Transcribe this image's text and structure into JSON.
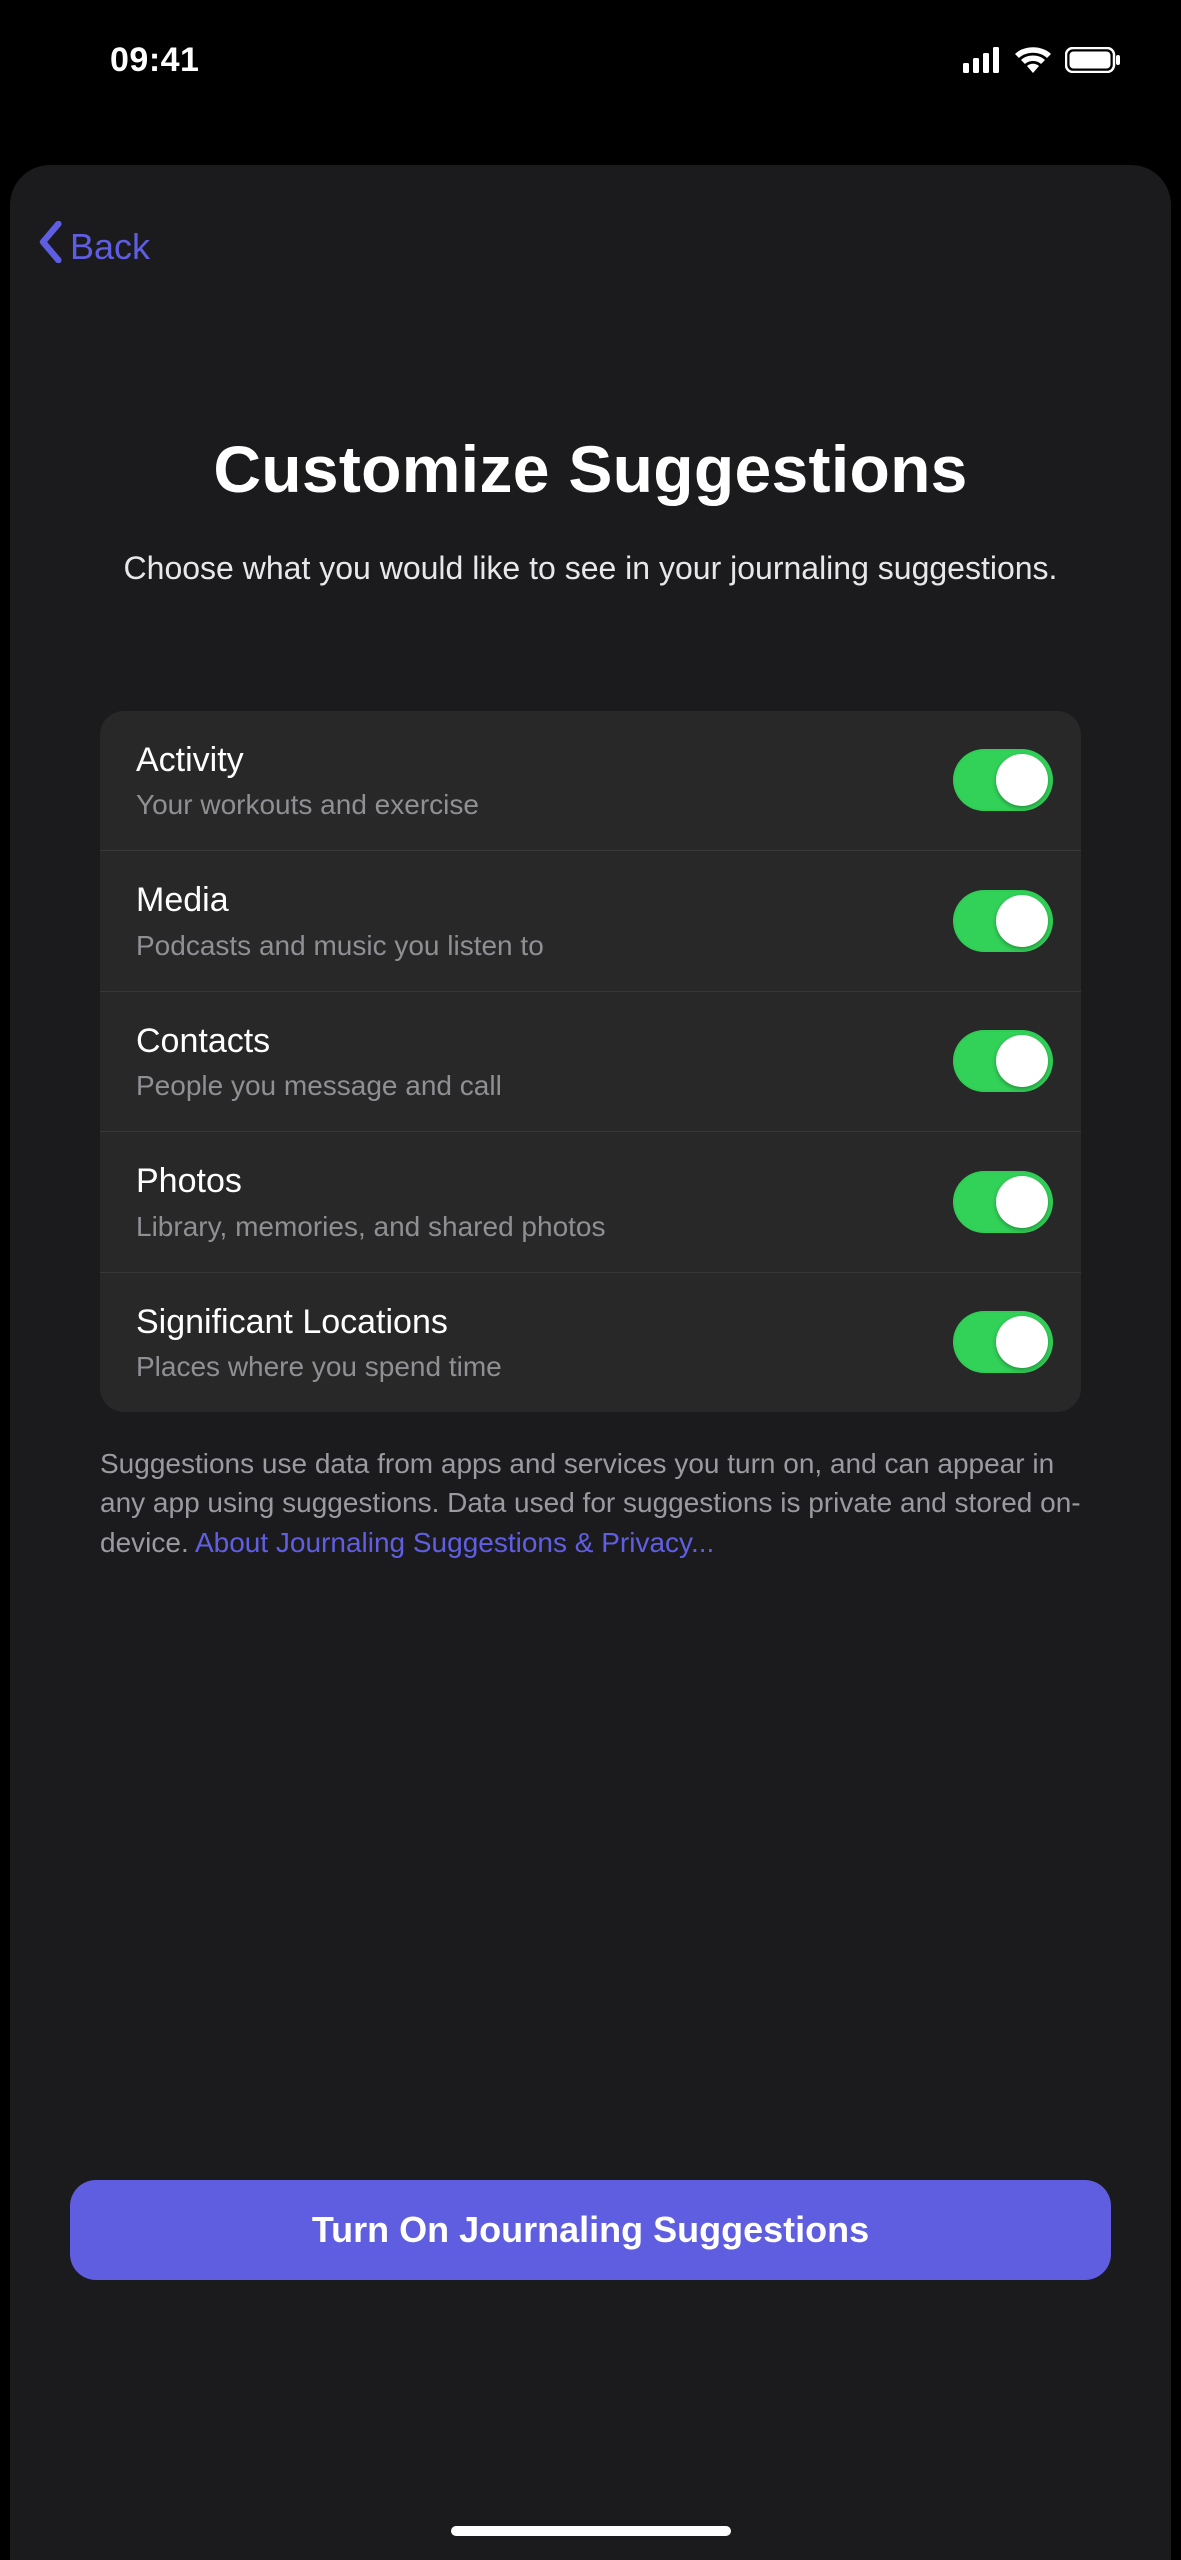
{
  "status": {
    "time": "09:41"
  },
  "nav": {
    "back_label": "Back"
  },
  "header": {
    "title": "Customize Suggestions",
    "subtitle": "Choose what you would like to see in your journaling suggestions."
  },
  "settings": [
    {
      "title": "Activity",
      "subtitle": "Your workouts and exercise",
      "on": true
    },
    {
      "title": "Media",
      "subtitle": "Podcasts and music you listen to",
      "on": true
    },
    {
      "title": "Contacts",
      "subtitle": "People you message and call",
      "on": true
    },
    {
      "title": "Photos",
      "subtitle": "Library, memories, and shared photos",
      "on": true
    },
    {
      "title": "Significant Locations",
      "subtitle": "Places where you spend time",
      "on": true
    }
  ],
  "footer": {
    "text": "Suggestions use data from apps and services you turn on, and can appear in any app using suggestions. Data used for suggestions is private and stored on-device. ",
    "link_text": "About Journaling Suggestions & Privacy..."
  },
  "primary_button": {
    "label": "Turn On Journaling Suggestions"
  }
}
